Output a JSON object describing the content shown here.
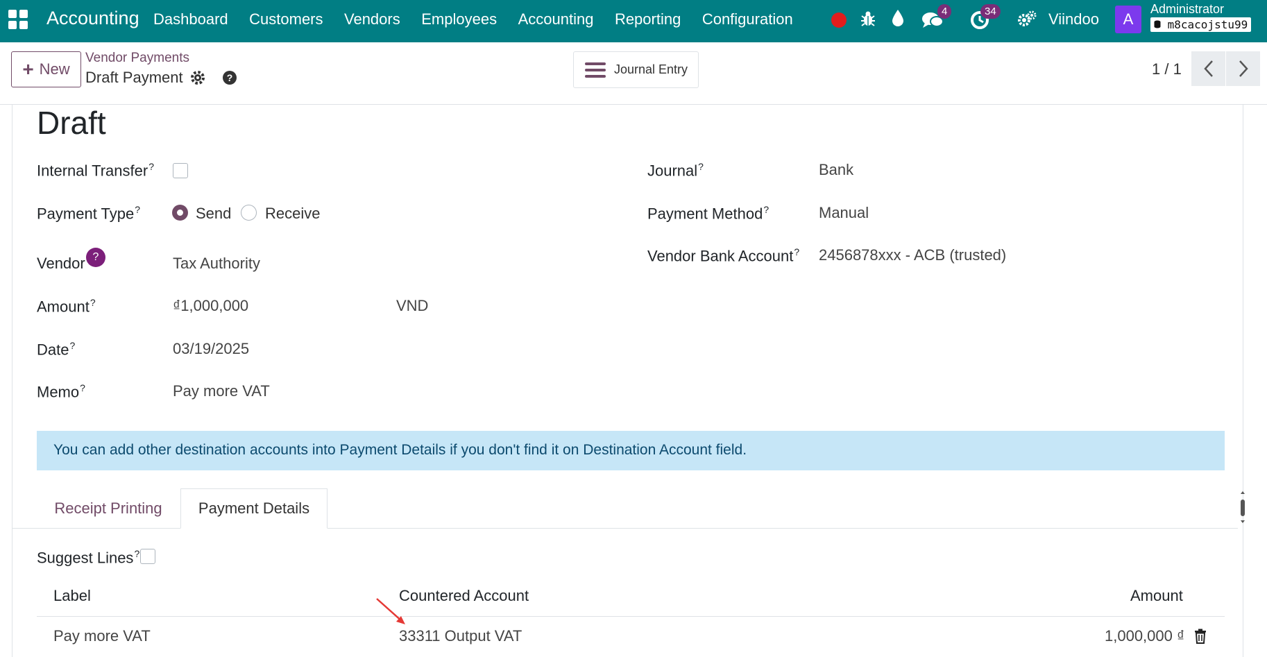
{
  "navbar": {
    "brand": "Accounting",
    "menu": [
      "Dashboard",
      "Customers",
      "Vendors",
      "Employees",
      "Accounting",
      "Reporting",
      "Configuration"
    ],
    "chat_count": "4",
    "activity_count": "34",
    "company": "Viindoo",
    "avatar_letter": "A",
    "user_name": "Administrator",
    "db_name": "m8cacojstu99"
  },
  "control": {
    "new_label": "New",
    "breadcrumb": "Vendor Payments",
    "record_title": "Draft Payment",
    "smart_button": "Journal Entry",
    "pager": "1 / 1"
  },
  "form": {
    "status": "Draft",
    "internal_transfer_label": "Internal Transfer",
    "payment_type_label": "Payment Type",
    "send_label": "Send",
    "receive_label": "Receive",
    "vendor_label": "Vendor",
    "vendor_value": "Tax Authority",
    "amount_label": "Amount",
    "amount_value": "₫1,000,000",
    "currency_value": "VND",
    "date_label": "Date",
    "date_value": "03/19/2025",
    "memo_label": "Memo",
    "memo_value": "Pay more VAT",
    "journal_label": "Journal",
    "journal_value": "Bank",
    "payment_method_label": "Payment Method",
    "payment_method_value": "Manual",
    "bank_account_label": "Vendor Bank Account",
    "bank_account_value": "2456878xxx - ACB (trusted)",
    "help_mark": "?",
    "tooltip_mark": "?"
  },
  "alert": "You can add other destination accounts into Payment Details if you don't find it on Destination Account field.",
  "tabs": [
    "Receipt Printing",
    "Payment Details"
  ],
  "details": {
    "suggest_lines_label": "Suggest Lines",
    "columns": [
      "Label",
      "Countered Account",
      "Amount"
    ],
    "rows": [
      {
        "label": "Pay more VAT",
        "account": "33311 Output VAT",
        "amount": "1,000,000 ₫"
      }
    ]
  },
  "colors": {
    "navbar": "#017e84",
    "primary": "#714b67",
    "alert_bg": "#c6e6f7",
    "annotation_arrow": "#e53935"
  }
}
